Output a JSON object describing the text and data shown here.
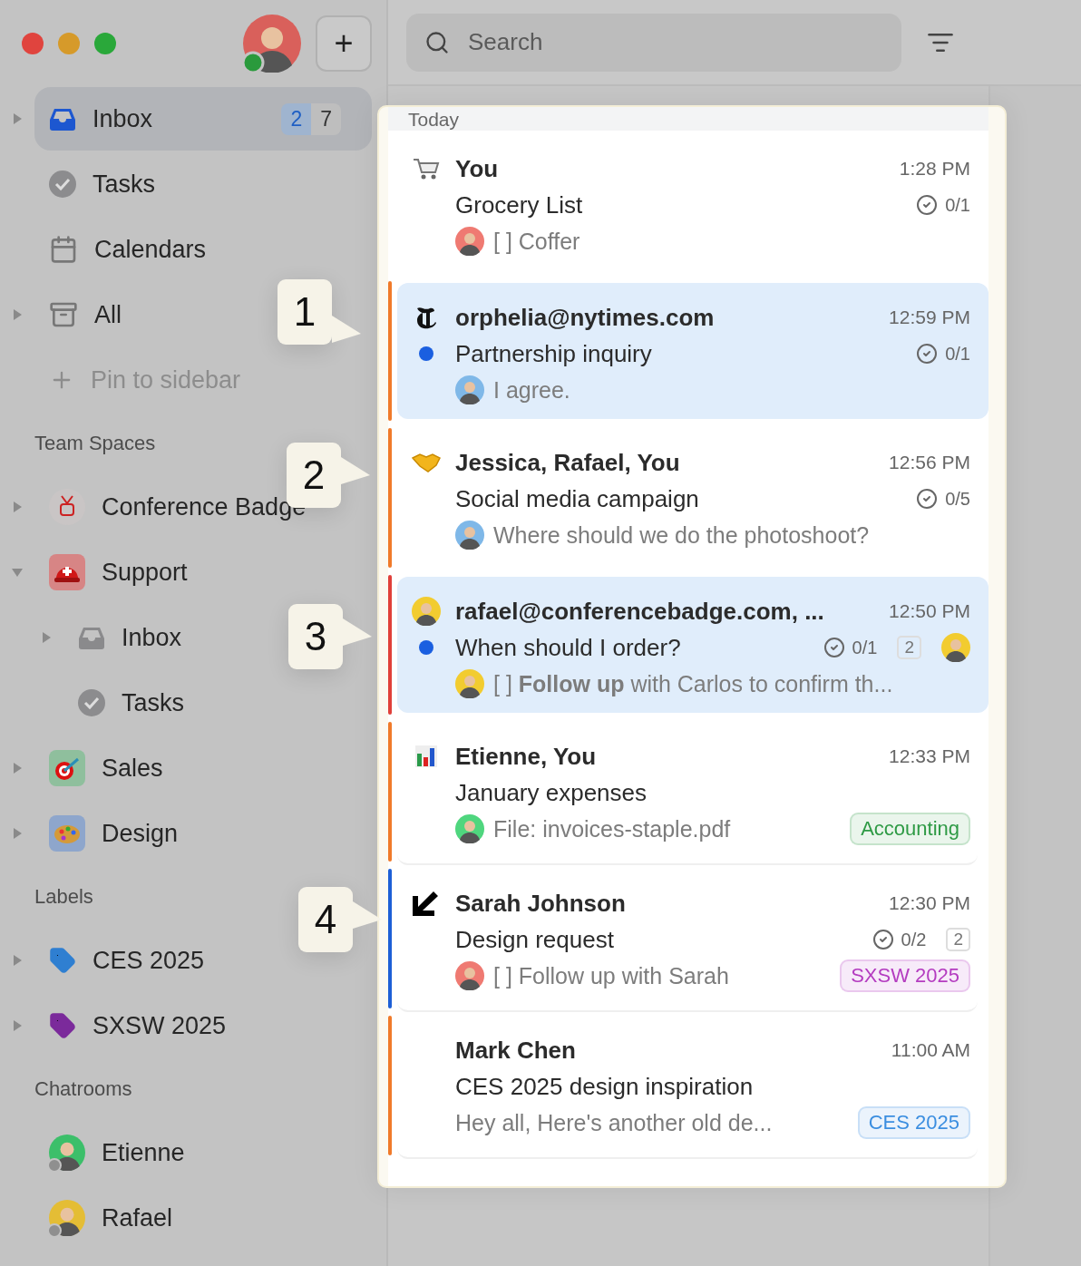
{
  "toolbar": {
    "add_button": "+"
  },
  "nav": [
    {
      "label": "Inbox",
      "expanded": false,
      "selected": true,
      "unread": "2",
      "total": "7"
    },
    {
      "label": "Tasks",
      "selected": false
    },
    {
      "label": "Calendars",
      "selected": false
    },
    {
      "label": "All",
      "expanded": false,
      "selected": false
    },
    {
      "label": "Pin to sidebar",
      "kind": "action",
      "selected": false
    }
  ],
  "sections": [
    {
      "title": "Team Spaces",
      "items": [
        {
          "label": "Conference Badge",
          "expanded": false
        },
        {
          "label": "Support",
          "expanded": true,
          "children": [
            {
              "label": "Inbox",
              "expanded": false
            },
            {
              "label": "Tasks"
            }
          ]
        },
        {
          "label": "Sales",
          "expanded": false
        },
        {
          "label": "Design",
          "expanded": false
        }
      ]
    },
    {
      "title": "Labels",
      "items": [
        {
          "label": "CES 2025",
          "color": "#2f7fd1",
          "expanded": false
        },
        {
          "label": "SXSW 2025",
          "color": "#7b2a9b",
          "expanded": false
        }
      ]
    },
    {
      "title": "Chatrooms",
      "items": [
        {
          "label": "Etienne",
          "color": "#3cbf6a"
        },
        {
          "label": "Rafael",
          "color": "#e4bd35"
        }
      ]
    }
  ],
  "search": {
    "placeholder": "Search"
  },
  "list": {
    "group": "Today",
    "messages": [
      {
        "sender": "You",
        "time": "1:28 PM",
        "subject": "Grocery List",
        "unread": false,
        "selected": false,
        "tasks": "0/1",
        "preview": {
          "text": "[ ] Coffer",
          "color": "#ef7a72"
        }
      },
      {
        "color": "#f07a2a",
        "sender": "orphelia@nytimes.com",
        "time": "12:59 PM",
        "subject": "Partnership inquiry",
        "unread": true,
        "selected": true,
        "tasks": "0/1",
        "preview": {
          "text": "I agree.",
          "color": "#7fb8e8"
        }
      },
      {
        "color": "#f07a2a",
        "sender": "Jessica, Rafael, You",
        "time": "12:56 PM",
        "subject": "Social media campaign",
        "unread": false,
        "selected": false,
        "tasks": "0/5",
        "preview": {
          "text": "Where should we do the photoshoot?",
          "color": "#7fb8e8"
        }
      },
      {
        "color": "#e0403a",
        "sender": "rafael@conferencebadge.com, ...",
        "time": "12:50 PM",
        "subject": "When should I order?",
        "unread": true,
        "selected": true,
        "tasks": "0/1",
        "comments": "2",
        "preview": {
          "text": "[ ] **Follow up** with Carlos to confirm th...",
          "color": "#f2cc30"
        }
      },
      {
        "color": "#f07a2a",
        "sender": "Etienne, You",
        "time": "12:33 PM",
        "subject": "January expenses",
        "unread": false,
        "selected": false,
        "preview": {
          "text": "File: invoices-staple.pdf",
          "color": "#4fd67e"
        },
        "tag": {
          "text": "Accounting",
          "color": "#2e9a45"
        }
      },
      {
        "color": "#1d5fd6",
        "sender": "Sarah Johnson",
        "time": "12:30 PM",
        "subject": "Design request",
        "unread": false,
        "selected": false,
        "tasks": "0/2",
        "comments": "2",
        "preview": {
          "text": "[ ] Follow up with Sarah",
          "color": "#ef7a72"
        },
        "tag": {
          "text": "SXSW 2025",
          "color": "#b43cc0"
        }
      },
      {
        "color": "#f07a2a",
        "sender": "Mark Chen",
        "time": "11:00 AM",
        "subject": "CES 2025 design inspiration",
        "unread": false,
        "selected": false,
        "preview": {
          "text": "Hey all, Here's another old de..."
        },
        "tag": {
          "text": "CES 2025",
          "color": "#3b8ee0"
        }
      }
    ]
  },
  "callouts": [
    {
      "label": "1"
    },
    {
      "label": "2"
    },
    {
      "label": "3"
    },
    {
      "label": "4"
    }
  ]
}
